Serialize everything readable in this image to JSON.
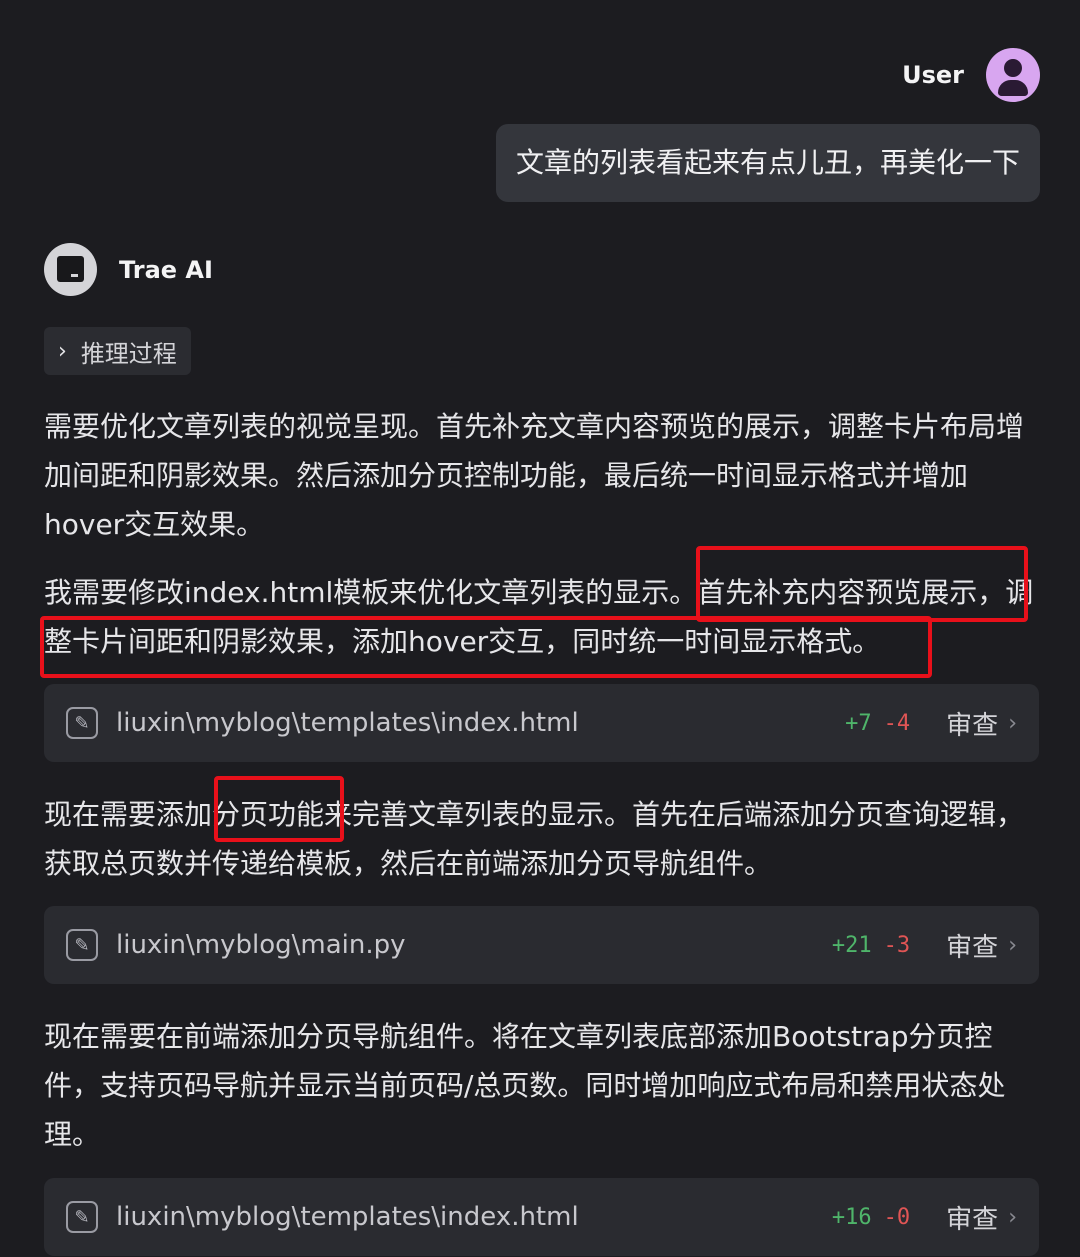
{
  "user": {
    "name": "User",
    "message": "文章的列表看起来有点儿丑，再美化一下"
  },
  "ai": {
    "name": "Trae AI",
    "reasoning_label": "推理过程"
  },
  "paragraphs": {
    "p1": "需要优化文章列表的视觉呈现。首先补充文章内容预览的展示，调整卡片布局增加间距和阴影效果。然后添加分页控制功能，最后统一时间显示格式并增加hover交互效果。",
    "p2": "我需要修改index.html模板来优化文章列表的显示。首先补充内容预览展示，调整卡片间距和阴影效果，添加hover交互，同时统一时间显示格式。",
    "p3": "现在需要添加分页功能来完善文章列表的显示。首先在后端添加分页查询逻辑，获取总页数并传递给模板，然后在前端添加分页导航组件。",
    "p4": "现在需要在前端添加分页导航组件。将在文章列表底部添加Bootstrap分页控件，支持页码导航并显示当前页码/总页数。同时增加响应式布局和禁用状态处理。"
  },
  "files": [
    {
      "path": "liuxin\\myblog\\templates\\index.html",
      "added": "+7",
      "removed": "-4",
      "review": "审查"
    },
    {
      "path": "liuxin\\myblog\\main.py",
      "added": "+21",
      "removed": "-3",
      "review": "审查"
    },
    {
      "path": "liuxin\\myblog\\templates\\index.html",
      "added": "+16",
      "removed": "-0",
      "review": "审查"
    }
  ],
  "colors": {
    "background": "#1c1c20",
    "diff_added": "#4fb56a",
    "diff_removed": "#e05555",
    "highlight_box": "#e8101a"
  },
  "icons": {
    "user_avatar": "person-icon",
    "ai_avatar": "terminal-icon",
    "reasoning": "chevron-right-icon",
    "file": "pencil-icon",
    "review": "chevron-right-icon"
  }
}
